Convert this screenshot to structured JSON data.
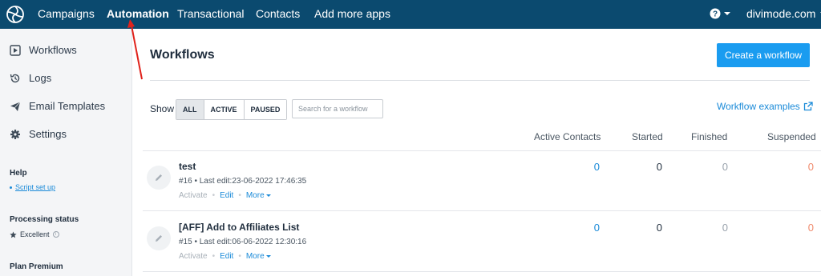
{
  "topnav": {
    "items": [
      "Campaigns",
      "Automation",
      "Transactional",
      "Contacts",
      "Add more apps"
    ],
    "active": "Automation",
    "account": "divimode.com",
    "help_icon": "question-circle-icon"
  },
  "sidebar": {
    "items": [
      {
        "label": "Workflows",
        "icon": "play-square-icon"
      },
      {
        "label": "Logs",
        "icon": "history-icon"
      },
      {
        "label": "Email Templates",
        "icon": "paper-plane-icon"
      },
      {
        "label": "Settings",
        "icon": "gear-icon"
      }
    ],
    "help_heading": "Help",
    "help_link": "Script set up",
    "processing_heading": "Processing status",
    "processing_value": "Excellent",
    "plan_heading": "Plan Premium"
  },
  "main": {
    "title": "Workflows",
    "create_button": "Create a workflow",
    "show_label": "Show",
    "filters": [
      "ALL",
      "ACTIVE",
      "PAUSED"
    ],
    "selected_filter": "ALL",
    "search_placeholder": "Search for a workflow",
    "examples_link": "Workflow examples",
    "columns": [
      "Active Contacts",
      "Started",
      "Finished",
      "Suspended"
    ],
    "rows": [
      {
        "name": "test",
        "meta": "#16 • Last edit:23-06-2022 17:46:35",
        "actions": [
          "Activate",
          "Edit",
          "More"
        ],
        "active_contacts": "0",
        "started": "0",
        "finished": "0",
        "suspended": "0"
      },
      {
        "name": "[AFF] Add to Affiliates List",
        "meta": "#15 • Last edit:06-06-2022 12:30:16",
        "actions": [
          "Activate",
          "Edit",
          "More"
        ],
        "active_contacts": "0",
        "started": "0",
        "finished": "0",
        "suspended": "0"
      }
    ]
  },
  "colors": {
    "topbar": "#0b4a6f",
    "primary": "#1a9cf0",
    "link": "#1a8ad8",
    "suspended": "#f08a6c",
    "annotation_arrow": "#e0231c"
  }
}
